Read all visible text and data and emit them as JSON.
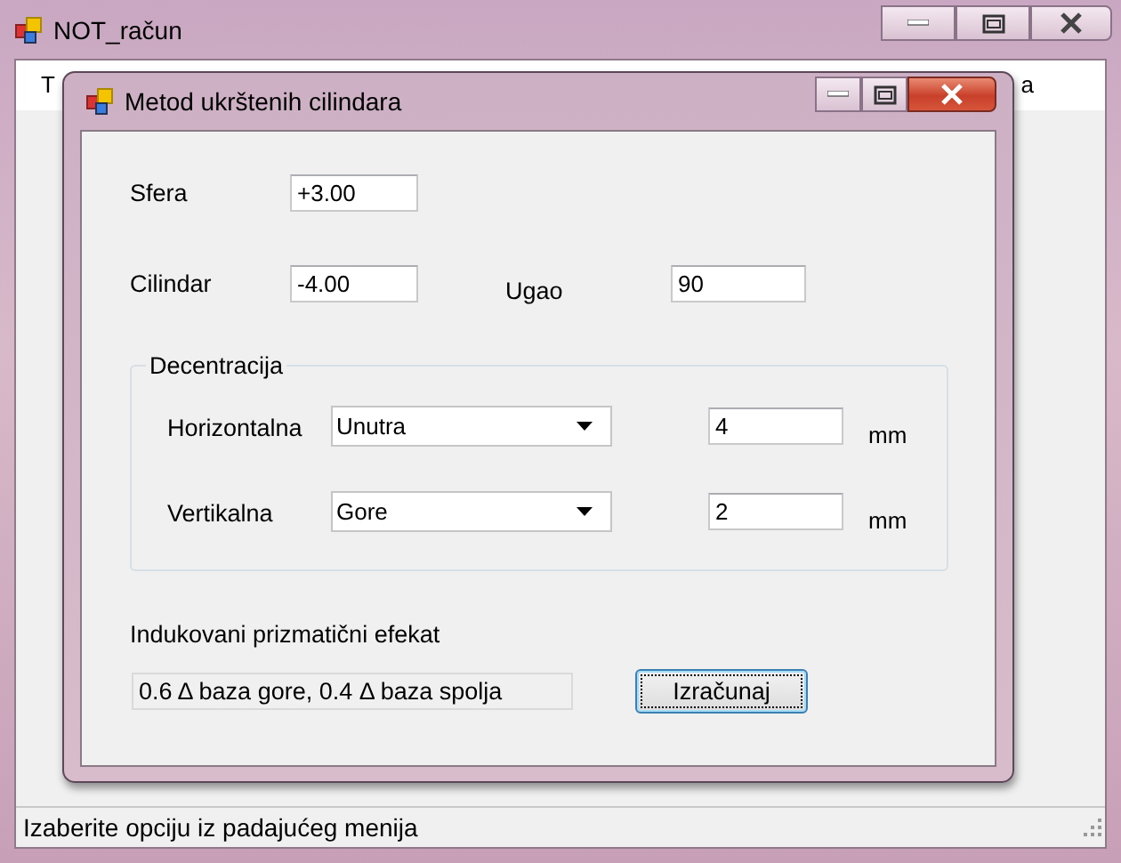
{
  "main_window": {
    "title": "NOT_račun",
    "menu": [
      {
        "label": "T"
      },
      {
        "label": "a"
      }
    ],
    "status_bar": "Izaberite opciju iz padajućeg menija"
  },
  "dialog": {
    "title": "Metod ukrštenih cilindara",
    "sfera": {
      "label": "Sfera",
      "value": "+3.00"
    },
    "cilindar": {
      "label": "Cilindar",
      "value": "-4.00"
    },
    "ugao": {
      "label": "Ugao",
      "value": "90"
    },
    "decentracija": {
      "title": "Decentracija",
      "rows": [
        {
          "label": "Horizontalna",
          "option": "Unutra",
          "value": "4",
          "unit": "mm"
        },
        {
          "label": "Vertikalna",
          "option": "Gore",
          "value": "2",
          "unit": "mm"
        }
      ]
    },
    "result": {
      "label": "Indukovani prizmatični efekat",
      "value": "0.6 Δ baza gore, 0.4 Δ baza spolja"
    },
    "button": {
      "label": "Izračunaj",
      "focused": true
    }
  }
}
